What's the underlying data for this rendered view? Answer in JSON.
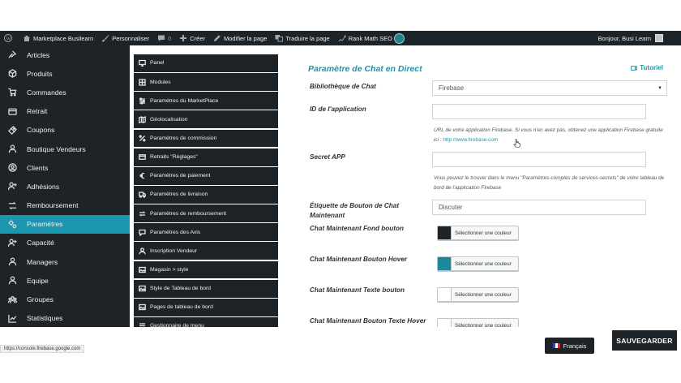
{
  "adminbar": {
    "site_name": "Marketplace Busilearn",
    "customize": "Personnaliser",
    "comments_count": "0",
    "new": "Créer",
    "edit_page": "Modifier la page",
    "translate_page": "Traduire la page",
    "seo": "Rank Math SEO",
    "greeting": "Bonjour, Busi Learn"
  },
  "sidebar": {
    "items": [
      {
        "label": "Articles",
        "icon": "pin-icon"
      },
      {
        "label": "Produits",
        "icon": "box-icon"
      },
      {
        "label": "Commandes",
        "icon": "cart-icon"
      },
      {
        "label": "Retrait",
        "icon": "wallet-icon"
      },
      {
        "label": "Coupons",
        "icon": "gift-icon"
      },
      {
        "label": "Boutique Vendeurs",
        "icon": "user-icon"
      },
      {
        "label": "Clients",
        "icon": "user-circle-icon"
      },
      {
        "label": "Adhésions",
        "icon": "user-plus-icon"
      },
      {
        "label": "Remboursement",
        "icon": "refund-icon"
      },
      {
        "label": "Paramètres",
        "icon": "gears-icon",
        "active": true
      },
      {
        "label": "Capacité",
        "icon": "user-plus-icon"
      },
      {
        "label": "Managers",
        "icon": "user-icon"
      },
      {
        "label": "Equipe",
        "icon": "user-icon"
      },
      {
        "label": "Groupes",
        "icon": "group-icon"
      },
      {
        "label": "Statistiques",
        "icon": "chart-icon"
      }
    ]
  },
  "submenu": {
    "items": [
      {
        "label": "Panel",
        "icon": "monitor-icon"
      },
      {
        "label": "Modules",
        "icon": "modules-icon"
      },
      {
        "label": "Paramètres du MarketPlace",
        "icon": "sliders-icon"
      },
      {
        "label": "Géolocalisation",
        "icon": "location-icon"
      },
      {
        "label": "Paramètres de commission",
        "icon": "percent-icon"
      },
      {
        "label": "Retraits \"Réglages\"",
        "icon": "card-icon"
      },
      {
        "label": "Paramètres de paiement",
        "icon": "euro-icon"
      },
      {
        "label": "Paramètres de livraison",
        "icon": "truck-icon"
      },
      {
        "label": "Paramètres de remboursement",
        "icon": "return-icon"
      },
      {
        "label": "Paramètres des Avis",
        "icon": "comment-icon"
      },
      {
        "label": "Inscription Vendeur",
        "icon": "user-icon"
      },
      {
        "label": "Magasin > style",
        "icon": "image-icon"
      },
      {
        "label": "Style de Tableau de bord",
        "icon": "image-icon"
      },
      {
        "label": "Pages de tableau de bord",
        "icon": "image-icon"
      },
      {
        "label": "Gestionnaire de menu",
        "icon": "menu-icon"
      }
    ]
  },
  "main": {
    "title": "Paramètre de Chat en Direct",
    "tutorial": "Tutoriel",
    "library_label": "Bibliothèque de Chat",
    "library_value": "Firebase",
    "app_id_label": "ID de l'application",
    "app_id_value": "",
    "app_id_help": "URL de votre application Firebase. Si vous n'en avez pas, obtenez une application Firebase gratuite ici :",
    "app_id_help_link": "http://www.firebase.com",
    "secret_label": "Secret APP",
    "secret_value": "",
    "secret_help": "Vous pouvez le trouver dans le menu \"Paramètres-comptes de services-secrets\" de votre tableau de bord de l'application Firebase",
    "button_label_label": "Étiquette de Bouton de Chat Maintenant",
    "button_label_value": "Discuter",
    "color_button_text": "Sélectionner une couleur",
    "colors": [
      {
        "label": "Chat Maintenant Fond bouton",
        "color": "#1d2327"
      },
      {
        "label": "Chat Maintenant Bouton Hover",
        "color": "#1a8a9b"
      },
      {
        "label": "Chat Maintenant Texte bouton",
        "color": "#ffffff"
      },
      {
        "label": "Chat Maintenant Bouton Texte Hover",
        "color": "#ffffff"
      }
    ]
  },
  "footer": {
    "status_url": "https://console.firebase.google.com",
    "language": "Français",
    "save": "SAUVEGARDER"
  },
  "colors": {
    "accent": "#1a96b0",
    "dark": "#1d2327"
  }
}
